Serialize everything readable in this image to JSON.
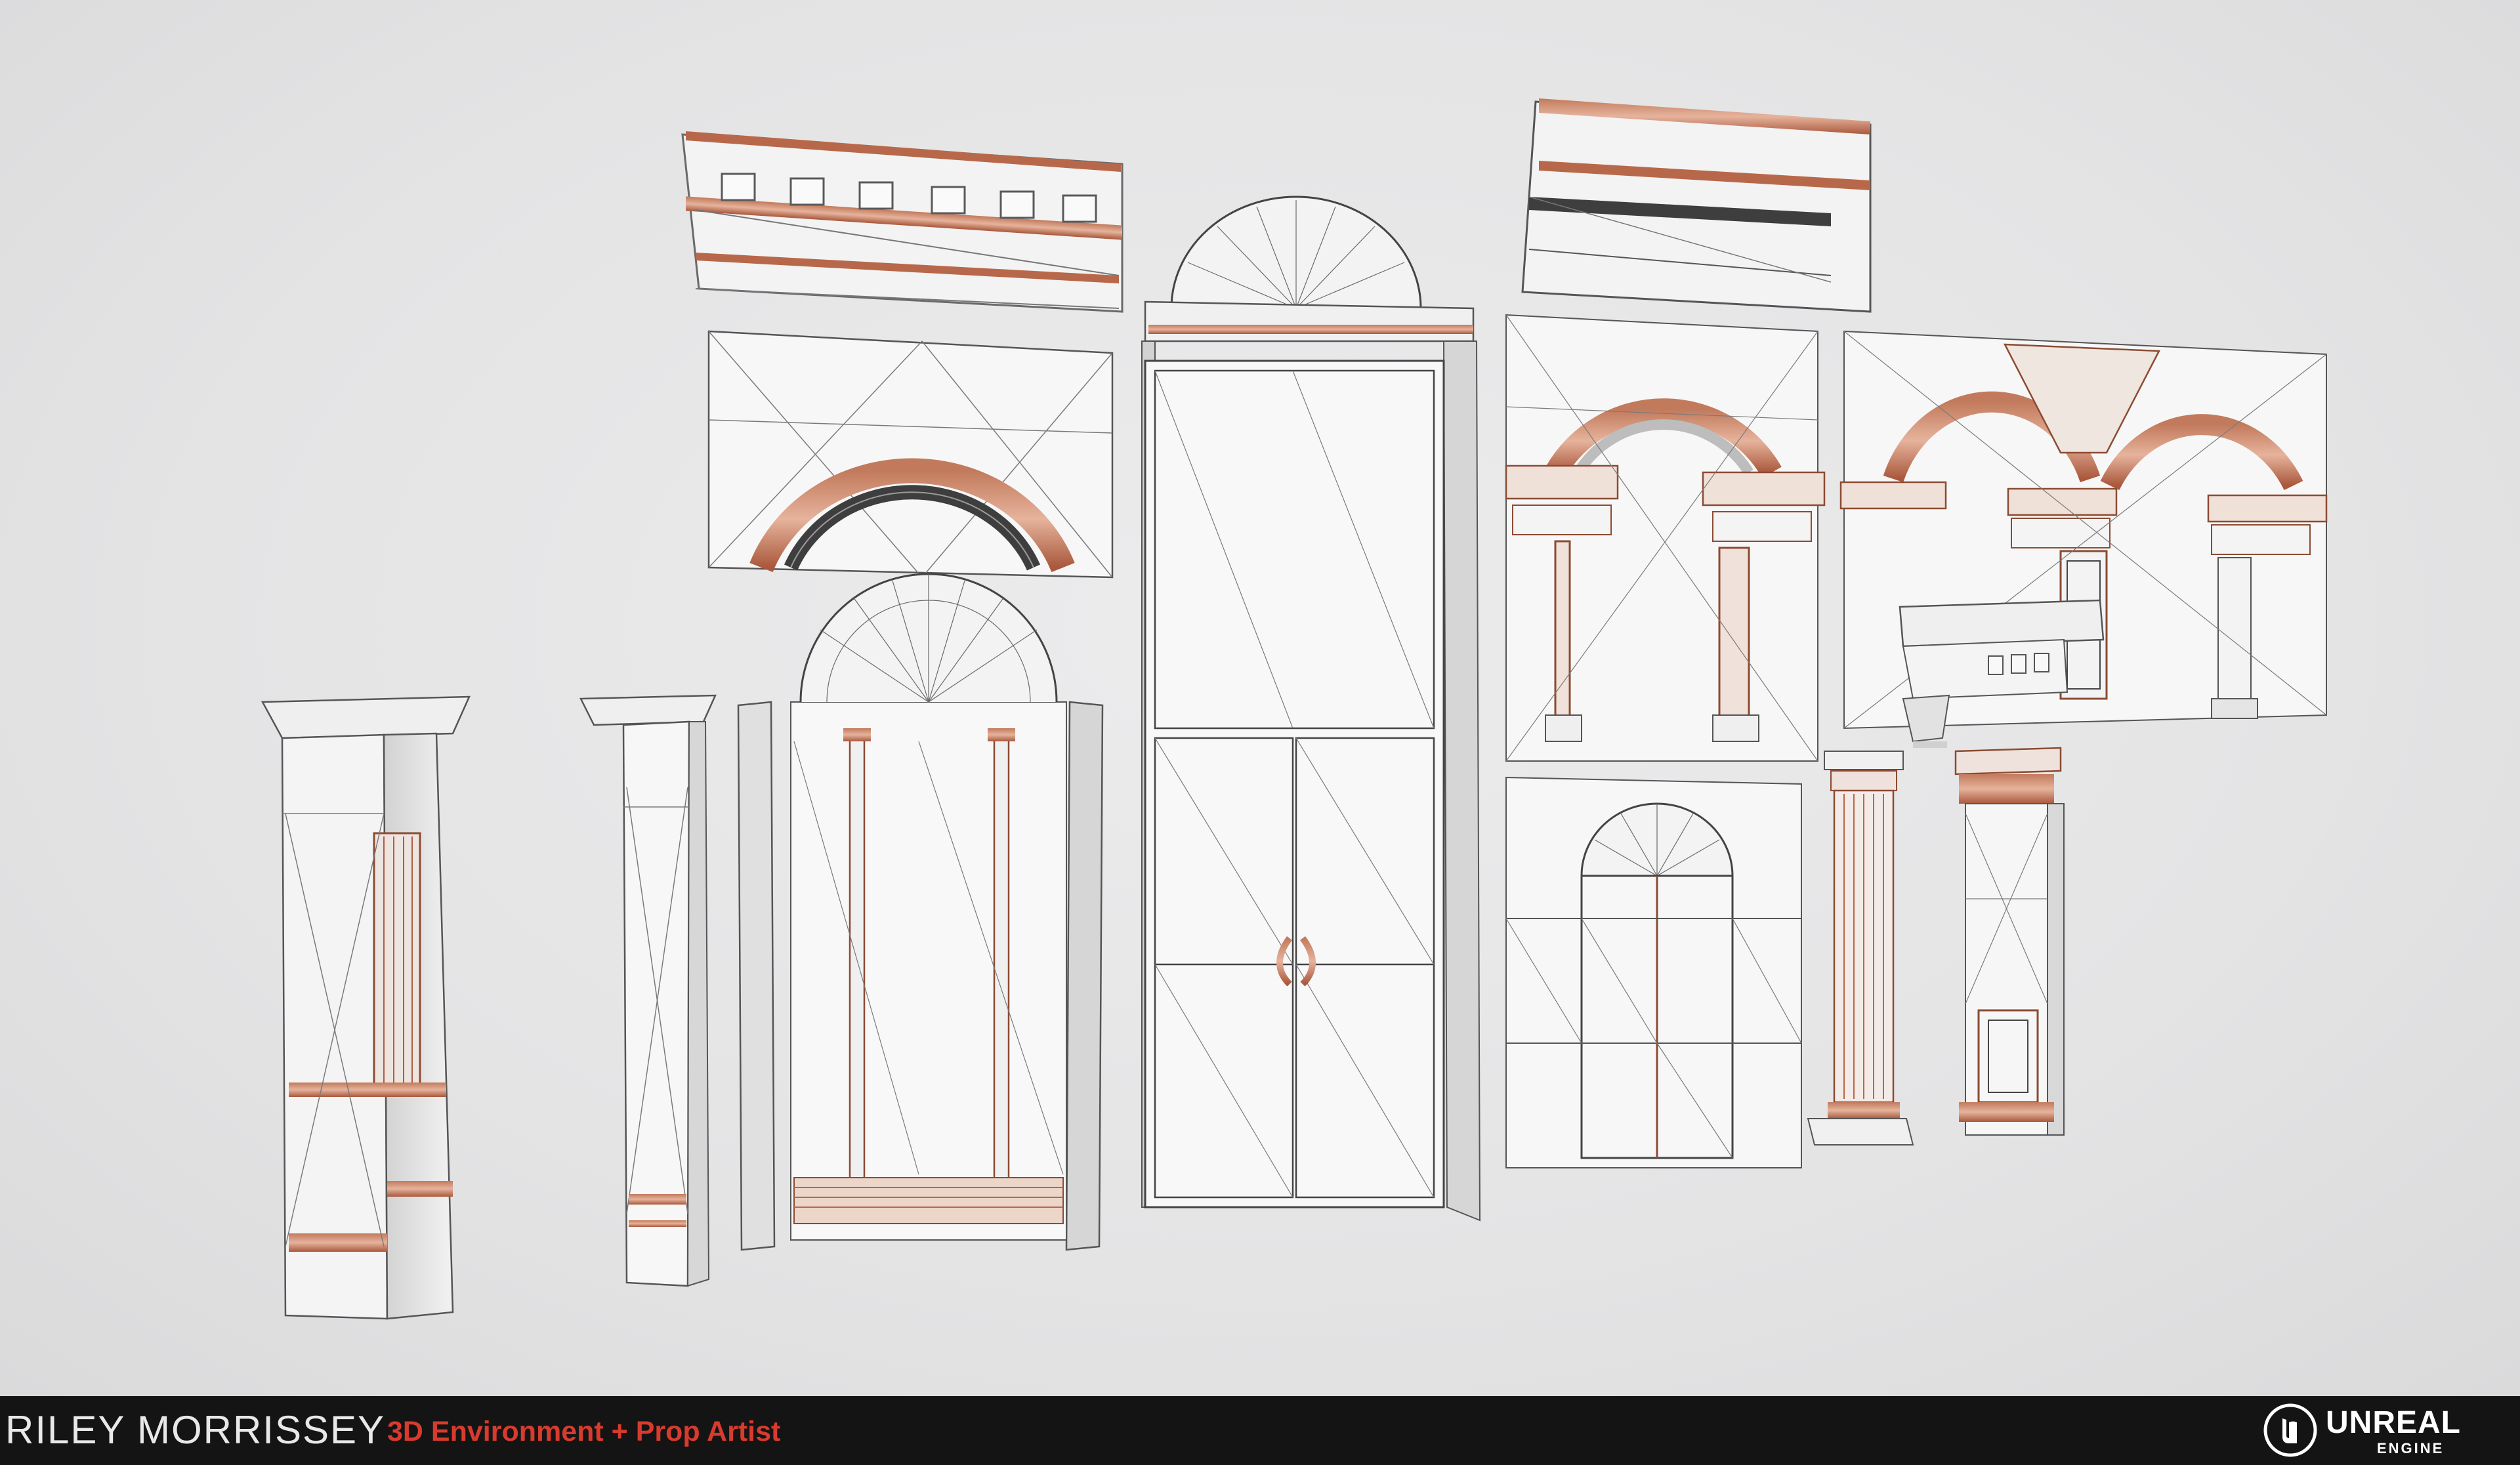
{
  "footer": {
    "artist_name": "RILEY MORRISSEY",
    "artist_role": "3D Environment + Prop Artist",
    "engine_logo_word": "UNREAL",
    "engine_logo_sub": "ENGINE"
  },
  "colors": {
    "background": "#e6e6e7",
    "footer_bg": "#141414",
    "role_text": "#d83b2e",
    "mesh_surface": "#f4f4f4",
    "wireframe_accent": "#b8684a",
    "wire_dark": "#555555"
  },
  "icons": [
    "unreal-engine-logo-icon"
  ]
}
